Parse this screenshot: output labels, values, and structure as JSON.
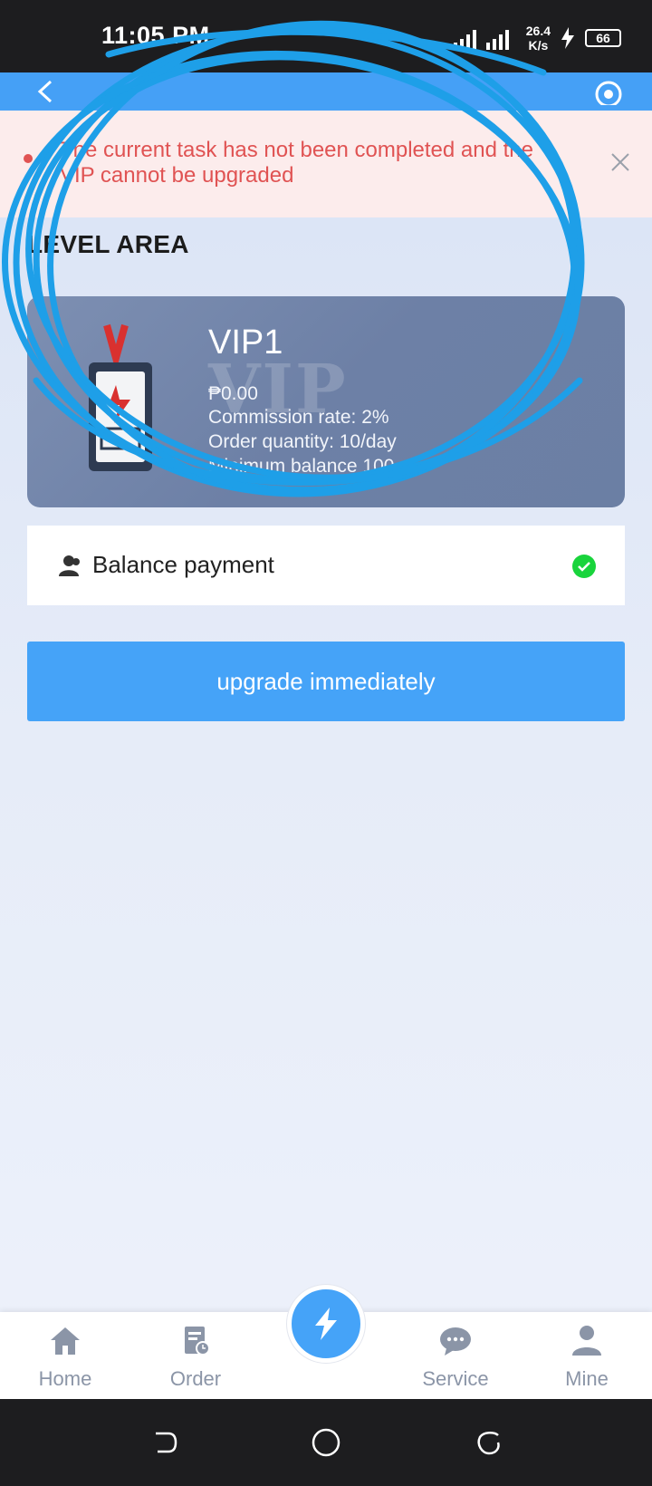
{
  "status_bar": {
    "time": "11:05 PM",
    "network_speed": "26.4",
    "network_unit": "K/s",
    "battery": "66"
  },
  "toast": {
    "message": "The current task has not been completed and the VIP cannot be upgraded"
  },
  "section": {
    "title": "LEVEL AREA"
  },
  "vip_card": {
    "name": "VIP1",
    "watermark": "VIP",
    "price": "₱0.00",
    "commission": "Commission rate: 2%",
    "orders": "Order quantity: 10/day",
    "min_balance": "Minimum balance 100"
  },
  "payment": {
    "label": "Balance payment",
    "selected": true
  },
  "upgrade_button": {
    "label": "upgrade immediately"
  },
  "bottom_nav": {
    "home": "Home",
    "order": "Order",
    "service": "Service",
    "mine": "Mine"
  },
  "colors": {
    "accent": "#45a3f8",
    "error": "#e05353",
    "success": "#19d43c",
    "scribble": "#1e9fe8"
  }
}
